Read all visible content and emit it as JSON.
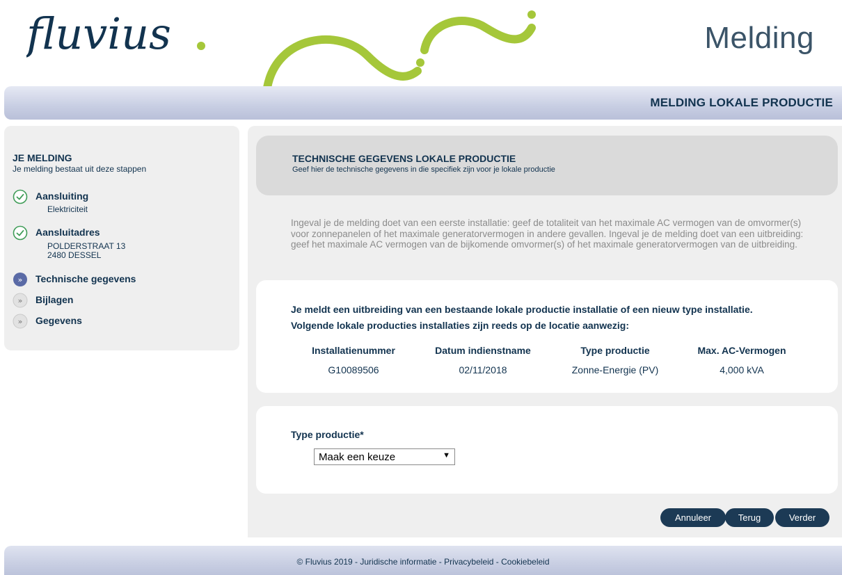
{
  "header": {
    "logo_text": "fluvius.",
    "page_heading": "Melding",
    "title_bar": "MELDING LOKALE PRODUCTIE",
    "colors": {
      "brand_dark": "#12334f",
      "brand_green": "#a5c73a"
    }
  },
  "sidebar": {
    "title": "JE MELDING",
    "subtitle": "Je melding bestaat uit deze stappen",
    "steps": [
      {
        "label": "Aansluiting",
        "details": [
          "Elektriciteit"
        ],
        "status": "done",
        "icon": "check-circle-icon"
      },
      {
        "label": "Aansluitadres",
        "details": [
          "POLDERSTRAAT 13",
          "2480 DESSEL"
        ],
        "status": "done",
        "icon": "check-circle-icon"
      },
      {
        "label": "Technische gegevens",
        "details": [],
        "status": "current",
        "icon": "double-chevron-icon"
      },
      {
        "label": "Bijlagen",
        "details": [],
        "status": "todo",
        "icon": "double-chevron-icon"
      },
      {
        "label": "Gegevens",
        "details": [],
        "status": "todo",
        "icon": "double-chevron-icon"
      }
    ]
  },
  "main": {
    "section_title": "TECHNISCHE GEGEVENS LOKALE PRODUCTIE",
    "section_subtitle": "Geef hier de technische gegevens in die specifiek zijn voor je lokale productie",
    "intro": "Ingeval je de melding doet van een eerste installatie: geef de totaliteit van het maximale AC vermogen van de omvormer(s) voor zonnepanelen of het maximale generatorvermogen in andere gevallen. Ingeval je de melding doet van een uitbreiding: geef het maximale AC vermogen van de bijkomende omvormer(s) of het maximale generatorvermogen van de uitbreiding.",
    "existing": {
      "line1": "Je meldt een uitbreiding van een bestaande lokale productie installatie of een nieuw type installatie.",
      "line2": "Volgende lokale producties installaties zijn reeds op de locatie aanwezig:",
      "columns": [
        "Installatienummer",
        "Datum indienstname",
        "Type productie",
        "Max. AC-Vermogen"
      ],
      "rows": [
        [
          "G10089506",
          "02/11/2018",
          "Zonne-Energie (PV)",
          "4,000 kVA"
        ]
      ]
    },
    "form": {
      "type_label": "Type productie*",
      "type_value": "Maak een keuze",
      "dropdown_arrow": "▼"
    },
    "buttons": {
      "cancel": "Annuleer",
      "back": "Terug",
      "next": "Verder"
    }
  },
  "footer": {
    "text": "© Fluvius 2019 - Juridische informatie - Privacybeleid - Cookiebeleid"
  }
}
